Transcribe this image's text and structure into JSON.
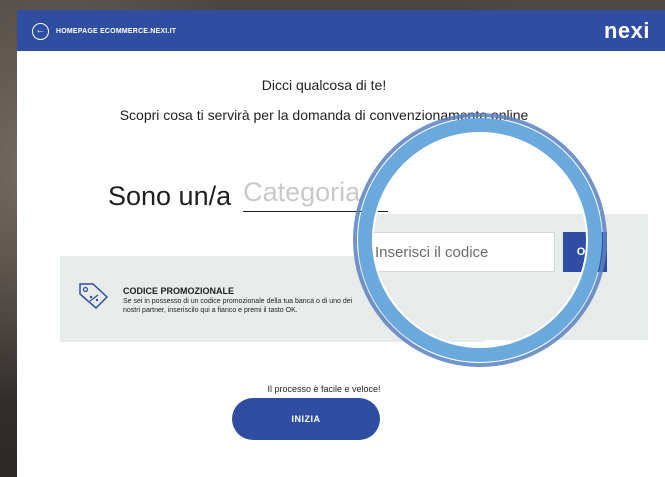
{
  "header": {
    "back_link": "HOMEPAGE ECOMMERCE.NEXI.IT",
    "logo": "nexi",
    "colors": {
      "brand": "#2f4ea2",
      "ring": "#6ba9dc"
    },
    "icons": {
      "back": "arrow-left-circle-icon"
    }
  },
  "intro": {
    "title": "Dicci qualcosa di te!",
    "subtitle": "Scopri cosa ti servirà per la domanda di convenzionamento online"
  },
  "profile": {
    "prefix": "Sono un/a",
    "category_placeholder": "Categoria"
  },
  "promo": {
    "title": "CODICE PROMOZIONALE",
    "description": "Se sei in possesso di un codice promozionale della tua banca o di uno dei nostri partner, inseriscilo qui a fianco e premi il tasto OK.",
    "input_placeholder": "Inserisci il codice",
    "ok_label": "OK",
    "icon": "tag-icon"
  },
  "footer": {
    "note": "Il processo è facile e veloce!",
    "start_label": "INIZIA"
  }
}
